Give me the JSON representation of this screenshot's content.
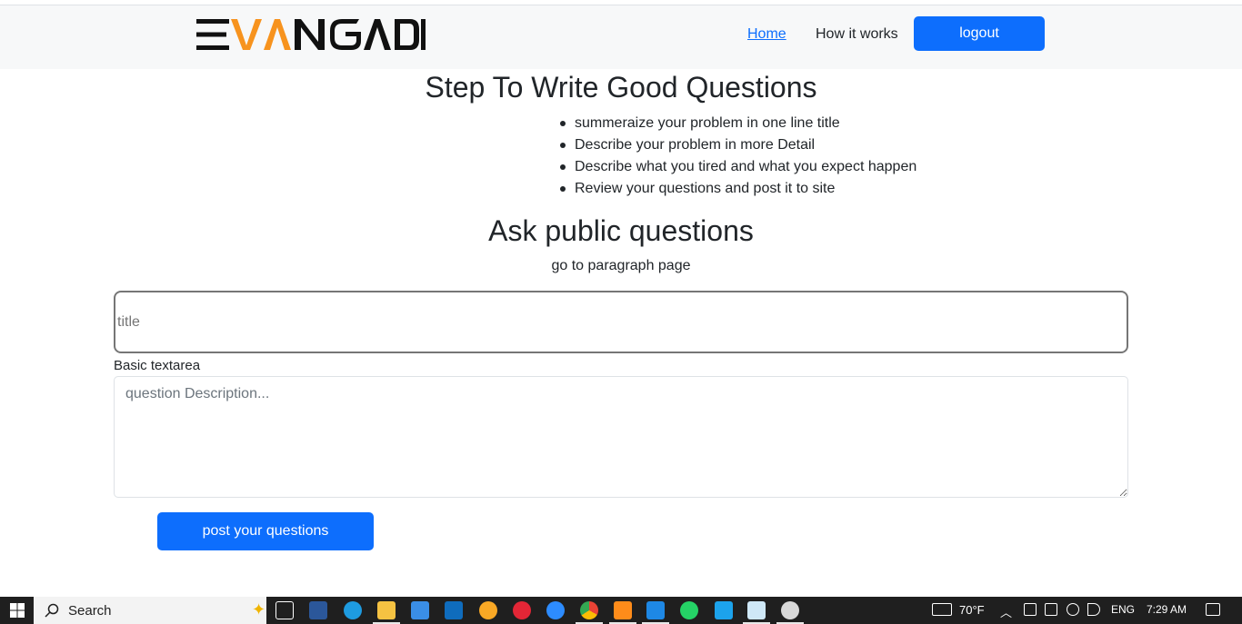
{
  "header": {
    "logo_text": "EVANGADI",
    "nav_home": "Home",
    "nav_how": "How it works",
    "logout_label": "logout"
  },
  "steps": {
    "title": "Step To Write Good Questions",
    "items": [
      "summeraize your problem in one line title",
      "Describe your problem in more Detail",
      "Describe what you tired and what you expect happen",
      "Review your questions and post it to site"
    ]
  },
  "ask": {
    "title": "Ask public questions",
    "subtitle": "go to paragraph page",
    "title_placeholder": "title",
    "textarea_label": "Basic textarea",
    "description_placeholder": "question Description...",
    "post_label": "post your questions"
  },
  "taskbar": {
    "search_label": "Search",
    "weather": "70°F",
    "language": "ENG",
    "time": "7:29 AM",
    "apps": [
      "task-view-icon",
      "word-icon",
      "edge-icon",
      "file-explorer-icon",
      "store-icon",
      "mail-icon",
      "brave-icon",
      "opera-icon",
      "zoom-icon",
      "chrome-icon",
      "sublime-icon",
      "vscode-icon",
      "whatsapp-icon",
      "mongodb-icon",
      "notepad-icon",
      "obs-icon"
    ]
  },
  "colors": {
    "accent": "#0d6efd",
    "logo_orange": "#f7931e",
    "header_bg": "#f7f8f9",
    "taskbar_bg": "#1f1f1f"
  }
}
